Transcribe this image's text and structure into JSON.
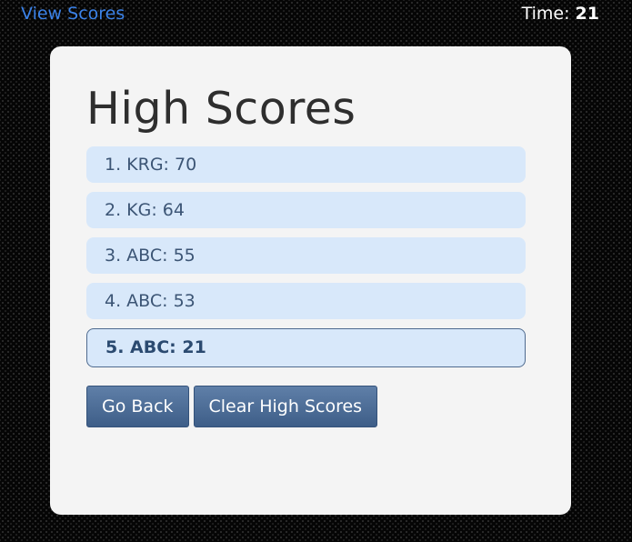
{
  "header": {
    "view_scores_link": "View Scores",
    "time_label": "Time:",
    "time_value": "21"
  },
  "main": {
    "title": "High Scores",
    "scores": [
      "1. KRG: 70",
      "2. KG: 64",
      "3. ABC: 55",
      "4. ABC: 53",
      "5. ABC: 21"
    ],
    "buttons": {
      "go_back": "Go Back",
      "clear": "Clear High Scores"
    }
  },
  "colors": {
    "link": "#3b82e8",
    "list_item_bg": "#d8e8fa",
    "button_bg": "#4e6e98",
    "card_bg": "#f4f4f4"
  }
}
